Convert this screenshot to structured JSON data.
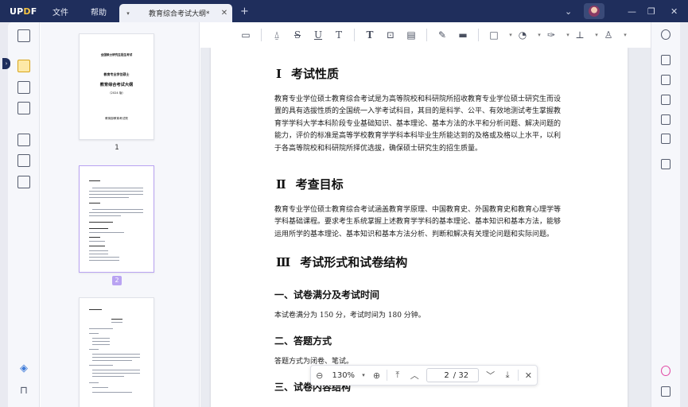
{
  "titlebar": {
    "logo": "UPDF",
    "menu": [
      "文件",
      "帮助"
    ],
    "tab_title": "教育综合考试大纲*"
  },
  "thumbnails": {
    "page1_number": "1",
    "page1_lines": [
      "全国硕士研究生招生考试",
      "教育专业学位硕士",
      "教育综合考试大纲",
      "（2024 版）",
      "教育部教育考试院"
    ],
    "page2_number": "2"
  },
  "document": {
    "section1": {
      "num": "Ⅰ",
      "title": "考试性质",
      "para": "教育专业学位硕士教育综合考试是为高等院校和科研院所招收教育专业学位硕士研究生而设置的具有选拔性质的全国统一入学考试科目，其目的是科学、公平、有效地测试考生掌握教育学学科大学本科阶段专业基础知识、基本理论、基本方法的水平和分析问题、解决问题的能力，评价的标准是高等学校教育学学科本科毕业生所能达到的及格或及格以上水平，以利于各高等院校和科研院所择优选拔，确保硕士研究生的招生质量。"
    },
    "section2": {
      "num": "Ⅱ",
      "title": "考查目标",
      "para": "教育专业学位硕士教育综合考试涵盖教育学原理、中国教育史、外国教育史和教育心理学等学科基础课程。要求考生系统掌握上述教育学学科的基本理论、基本知识和基本方法，能够运用所学的基本理论、基本知识和基本方法分析、判断和解决有关理论问题和实际问题。"
    },
    "section3": {
      "num": "Ⅲ",
      "title": "考试形式和试卷结构",
      "sub1_title": "一、试卷满分及考试时间",
      "sub1_text": "本试卷满分为 150 分，考试时间为 180 分钟。",
      "sub2_title": "二、答题方式",
      "sub2_text": "答题方式为闭卷、笔试。",
      "sub3_title": "三、试卷内容结构"
    }
  },
  "navbar": {
    "zoom": "130%",
    "current_page": "2",
    "total_pages": "/ 32"
  }
}
